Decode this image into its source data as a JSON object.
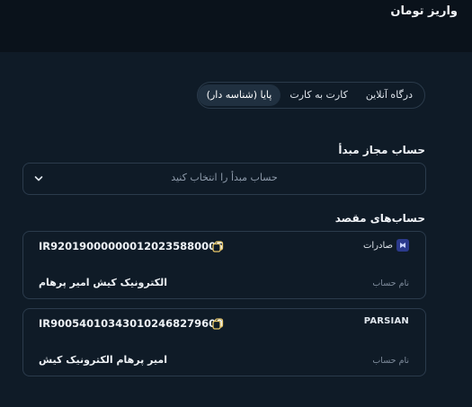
{
  "page": {
    "title": "واریز تومان"
  },
  "tabs": [
    {
      "label": "درگاه آنلاین",
      "active": false
    },
    {
      "label": "کارت به کارت",
      "active": false
    },
    {
      "label": "پایا (شناسه دار)",
      "active": true
    }
  ],
  "source": {
    "label": "حساب مجاز مبدأ",
    "placeholder": "حساب مبدأ را انتخاب کنید"
  },
  "destinations": {
    "label": "حساب‌های مقصد",
    "accounts": [
      {
        "bank": "صادرات",
        "iban": "IR920190000000120235880005",
        "name_label": "نام حساب",
        "name": "الکترونیک کیش امیر پرهام"
      },
      {
        "bank": "PARSIAN",
        "iban": "IR900540103430102468279600",
        "name_label": "نام حساب",
        "name": "امیر پرهام الکترونیک کیش"
      }
    ]
  },
  "colors": {
    "background": "#0f1b27",
    "header": "#0a121b",
    "border": "#2b3b4c",
    "copy_icon": "#e8c76a",
    "saderat_logo": "#2b3a8c"
  },
  "icons": {
    "chevron": "chevron-down-icon",
    "copy": "copy-icon",
    "bank_logo": "saderat-logo-icon"
  }
}
